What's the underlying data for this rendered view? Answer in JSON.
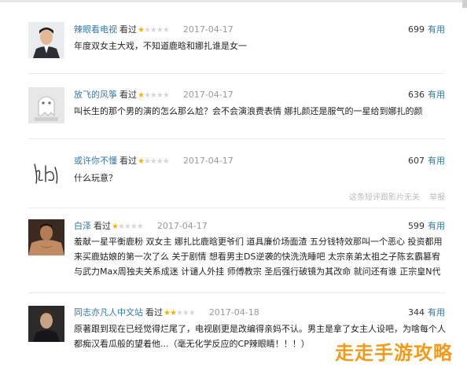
{
  "comments": [
    {
      "user": "辣眼看电视",
      "action": "看过",
      "rating": 1,
      "date": "2017-04-17",
      "votes": "699",
      "useful": "有用",
      "text": "年度双女主大戏，不知道鹿晗和娜扎谁是女一"
    },
    {
      "user": "放飞的风筝",
      "action": "看过",
      "rating": 1,
      "date": "2017-04-17",
      "votes": "636",
      "useful": "有用",
      "text": "叫长生的那个男的演的怎么那么尬？会不会演浪费表情 娜扎颜还是服气的一星给到娜扎的颜"
    },
    {
      "user": "或许你不懂",
      "action": "看过",
      "rating": 1,
      "date": "2017-04-17",
      "votes": "607",
      "useful": "有用",
      "text": "什么玩意？",
      "extra": [
        "这条短评跟影片无关",
        "举报"
      ]
    },
    {
      "user": "白泽",
      "action": "看过",
      "rating": 1,
      "date": "2017-04-17",
      "votes": "599",
      "useful": "有用",
      "text": "羞献一星平衡鹿粉 双女主 娜扎比鹿晗更爷们 道具廉价场面渣 五分钱特效那叫一个恶心 投资都用来买鹿姑娘的第一次了么 关于剧情 想看男主DS逆袭的快洗洗睡吧 太宗亲弟太祖之子陈玄霸篡宥 与武力Max周独夫关系成迷 计谴人外挂 师傅教宗 圣后强行破镜为其改命 就问还有谁 正宗皇N代"
    },
    {
      "user": "同志亦凡人中文站",
      "action": "看过",
      "rating": 2,
      "date": "2017-04-18",
      "votes": "344",
      "useful": "有用",
      "text": "原著跟到现在已经觉得烂尾了，电视剧更是改编得亲妈不认。男主是拿了女主人设吧，为啥每个人都痴汉看瓜般的望着他...（毫无化学反应的CP辣眼睛！！！）"
    }
  ],
  "watermark": "走走手游攻略",
  "colors": {
    "user_link": "#3377aa",
    "star_on": "#f5b400",
    "star_off": "#d6d6d6",
    "date": "#999999",
    "watermark": "#f39a1a"
  },
  "icons": [
    "avatar-man-suit",
    "avatar-ghost-cartoon",
    "avatar-signature",
    "avatar-shirtless",
    "avatar-man-dark"
  ]
}
